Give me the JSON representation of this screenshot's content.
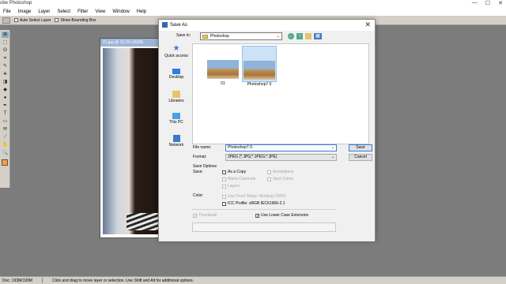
{
  "app": {
    "title": "obe Photoshop",
    "menu": [
      "File",
      "Image",
      "Layer",
      "Select",
      "Filter",
      "View",
      "Window",
      "Help"
    ],
    "window_controls": [
      "—",
      "☐",
      "✕"
    ]
  },
  "options_bar": {
    "auto_select_layer": "Auto Select Layer",
    "show_bounding_box": "Show Bounding Box"
  },
  "toolbox": {
    "tools": [
      "move-icon",
      "marquee-icon",
      "lasso-icon",
      "crop-icon",
      "brush-icon",
      "stamp-icon",
      "eraser-icon",
      "bucket-icon",
      "dodge-icon",
      "pen-icon",
      "type-icon",
      "shape-icon",
      "notes-icon",
      "eyedropper-icon",
      "hand-icon",
      "zoom-icon"
    ],
    "tool_glyphs": [
      "⊕",
      "⬚",
      "ʘ",
      "⌗",
      "✎",
      "⎈",
      "◨",
      "◆",
      "●",
      "✒",
      "T",
      "▭",
      "✉",
      "⟋",
      "✋",
      "🔍"
    ],
    "foreground_color": "#f6a33a"
  },
  "document": {
    "title": "01.jpg @ 33.3% (RGB)"
  },
  "status_bar": {
    "doc_info": "Doc: 193M/193M",
    "hint": "Click and drag to move layer or selection. Use Shift and Alt for additional options."
  },
  "dialog": {
    "title": "Save As",
    "close": "✕",
    "save_in_label": "Save in:",
    "save_in_value": "Photoshop",
    "places": [
      {
        "label": "Quick access",
        "icon": "quick-access-star-icon"
      },
      {
        "label": "Desktop",
        "icon": "desktop-icon"
      },
      {
        "label": "Libraries",
        "icon": "libraries-icon"
      },
      {
        "label": "This PC",
        "icon": "this-pc-icon"
      },
      {
        "label": "Network",
        "icon": "network-icon"
      }
    ],
    "files": [
      {
        "name": "01",
        "selected": false
      },
      {
        "name": "Photoshop7.0",
        "selected": true
      }
    ],
    "file_name_label": "File name:",
    "file_name_value": "Photoshop7.0.",
    "format_label": "Format:",
    "format_value": "JPEG (*.JPG;*.JPEG;*.JPE)",
    "save_button": "Save",
    "cancel_button": "Cancel",
    "save_options_label": "Save Options",
    "save_label": "Save:",
    "options": {
      "as_a_copy": "As a Copy",
      "annotations": "Annotations",
      "alpha_channels": "Alpha Channels",
      "spot_colors": "Spot Colors",
      "layers": "Layers"
    },
    "color_label": "Color:",
    "use_proof_setup": "Use Proof Setup:  Working CMYK",
    "icc_profile": "ICC Profile:  sRGB IEC61966-2.1",
    "thumbnail": "Thumbnail",
    "use_lower_case_extension": "Use Lower Case Extension"
  }
}
